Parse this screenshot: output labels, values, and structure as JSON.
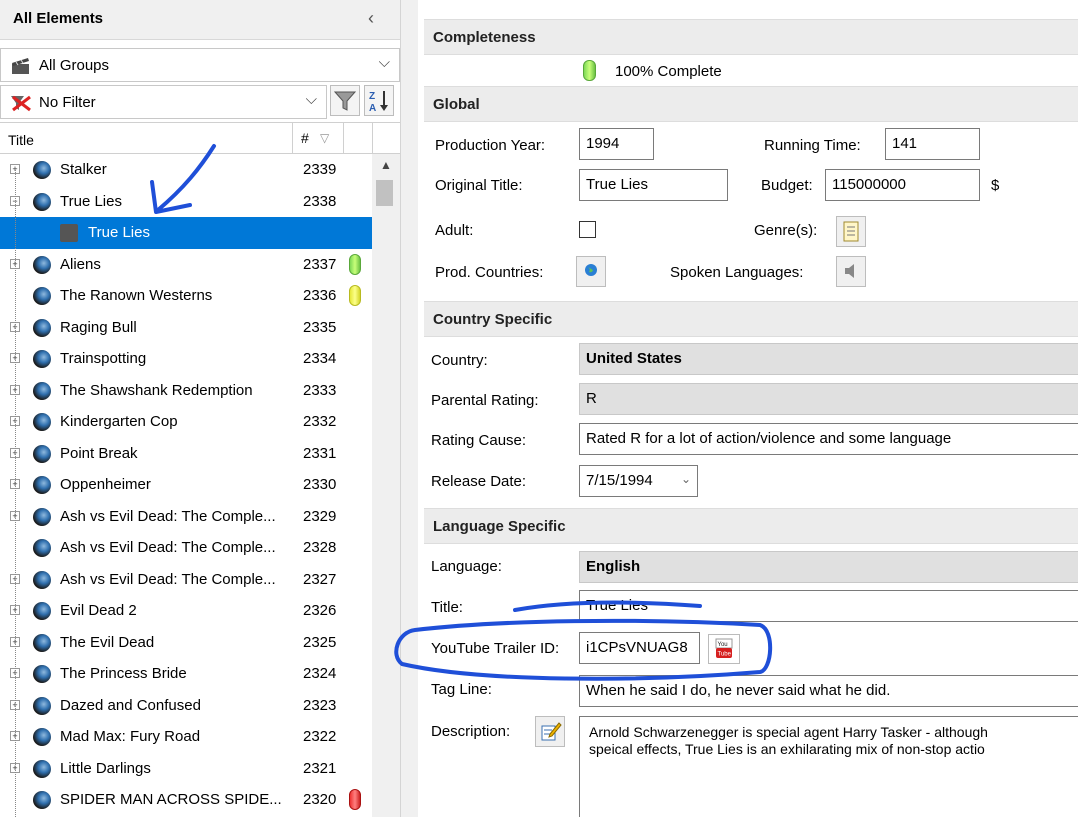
{
  "left_panel": {
    "title": "All Elements",
    "collapse_glyph": "‹",
    "groups_combo": {
      "value": "All Groups"
    },
    "filter_combo": {
      "value": "No Filter"
    },
    "columns": {
      "title": "Title",
      "number": "#"
    },
    "rows": [
      {
        "title": "Stalker",
        "number": "2339",
        "badge": "",
        "expander": "+"
      },
      {
        "title": "True Lies",
        "number": "2338",
        "badge": "",
        "expander": "−"
      },
      {
        "title": "True Lies",
        "number": "",
        "badge": "",
        "expander": "",
        "child": true,
        "selected": true
      },
      {
        "title": "Aliens",
        "number": "2337",
        "badge": "green",
        "expander": "+"
      },
      {
        "title": "The Ranown Westerns",
        "number": "2336",
        "badge": "yellow",
        "expander": ""
      },
      {
        "title": "Raging Bull",
        "number": "2335",
        "badge": "",
        "expander": "+"
      },
      {
        "title": "Trainspotting",
        "number": "2334",
        "badge": "",
        "expander": "+"
      },
      {
        "title": "The Shawshank Redemption",
        "number": "2333",
        "badge": "",
        "expander": "+"
      },
      {
        "title": "Kindergarten Cop",
        "number": "2332",
        "badge": "",
        "expander": "+"
      },
      {
        "title": "Point Break",
        "number": "2331",
        "badge": "",
        "expander": "+"
      },
      {
        "title": "Oppenheimer",
        "number": "2330",
        "badge": "",
        "expander": "+"
      },
      {
        "title": "Ash vs Evil Dead: The Comple...",
        "number": "2329",
        "badge": "",
        "expander": "+"
      },
      {
        "title": "Ash vs Evil Dead: The Comple...",
        "number": "2328",
        "badge": "",
        "expander": ""
      },
      {
        "title": "Ash vs Evil Dead: The Comple...",
        "number": "2327",
        "badge": "",
        "expander": "+"
      },
      {
        "title": "Evil Dead 2",
        "number": "2326",
        "badge": "",
        "expander": "+"
      },
      {
        "title": "The Evil Dead",
        "number": "2325",
        "badge": "",
        "expander": "+"
      },
      {
        "title": "The Princess Bride",
        "number": "2324",
        "badge": "",
        "expander": "+"
      },
      {
        "title": "Dazed and Confused",
        "number": "2323",
        "badge": "",
        "expander": "+"
      },
      {
        "title": "Mad Max: Fury Road",
        "number": "2322",
        "badge": "",
        "expander": "+"
      },
      {
        "title": "Little Darlings",
        "number": "2321",
        "badge": "",
        "expander": "+"
      },
      {
        "title": "SPIDER MAN ACROSS SPIDE...",
        "number": "2320",
        "badge": "red",
        "expander": ""
      }
    ]
  },
  "sections": {
    "completeness": {
      "title": "Completeness",
      "value": "100% Complete"
    },
    "global": {
      "title": "Global",
      "production_year_label": "Production Year:",
      "production_year": "1994",
      "running_time_label": "Running Time:",
      "running_time": "141",
      "original_title_label": "Original Title:",
      "original_title": "True Lies",
      "budget_label": "Budget:",
      "budget": "115000000",
      "currency": "$",
      "adult_label": "Adult:",
      "genres_label": "Genre(s):",
      "prod_countries_label": "Prod. Countries:",
      "spoken_languages_label": "Spoken Languages:"
    },
    "country": {
      "title": "Country Specific",
      "country_label": "Country:",
      "country": "United States",
      "parental_rating_label": "Parental Rating:",
      "parental_rating": "R",
      "rating_cause_label": "Rating Cause:",
      "rating_cause": "Rated R for a lot of action/violence and some language",
      "release_date_label": "Release Date:",
      "release_date": "7/15/1994"
    },
    "language": {
      "title": "Language Specific",
      "language_label": "Language:",
      "language": "English",
      "title_label": "Title:",
      "title_value": "True Lies",
      "youtube_label": "YouTube Trailer ID:",
      "youtube_id": "i1CPsVNUAG8",
      "youtube_btn": "You Tube",
      "tagline_label": "Tag Line:",
      "tagline": "When he said I do, he never said what he did.",
      "description_label": "Description:",
      "description_line1": "Arnold Schwarzenegger is special agent Harry Tasker - although",
      "description_line2": "speical effects, True Lies is an exhilarating mix of non-stop actio"
    }
  },
  "colors": {
    "selection": "#0078d7",
    "annotation_ink": "#1f4fd8"
  }
}
